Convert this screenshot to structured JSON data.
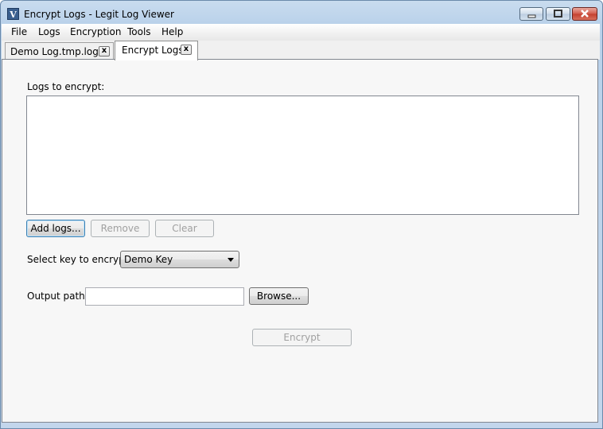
{
  "window": {
    "title": "Encrypt Logs - Legit Log Viewer",
    "icon_glyph": "V",
    "icon": "app-logo-icon"
  },
  "menu": [
    "File",
    "Logs",
    "Encryption",
    "Tools",
    "Help"
  ],
  "tabs": [
    {
      "label": "Demo Log.tmp.log",
      "close": "x",
      "active": false
    },
    {
      "label": "Encrypt Logs",
      "close": "x",
      "active": true
    }
  ],
  "encrypt_panel": {
    "logs_label": "Logs to encrypt:",
    "logs": [],
    "add_button": "Add logs...",
    "remove_button": "Remove",
    "clear_button": "Clear",
    "key_label": "Select key to encrypt:",
    "key_selected": "Demo Key",
    "output_label": "Output path:",
    "output_value": "",
    "browse_button": "Browse...",
    "encrypt_button": "Encrypt"
  }
}
